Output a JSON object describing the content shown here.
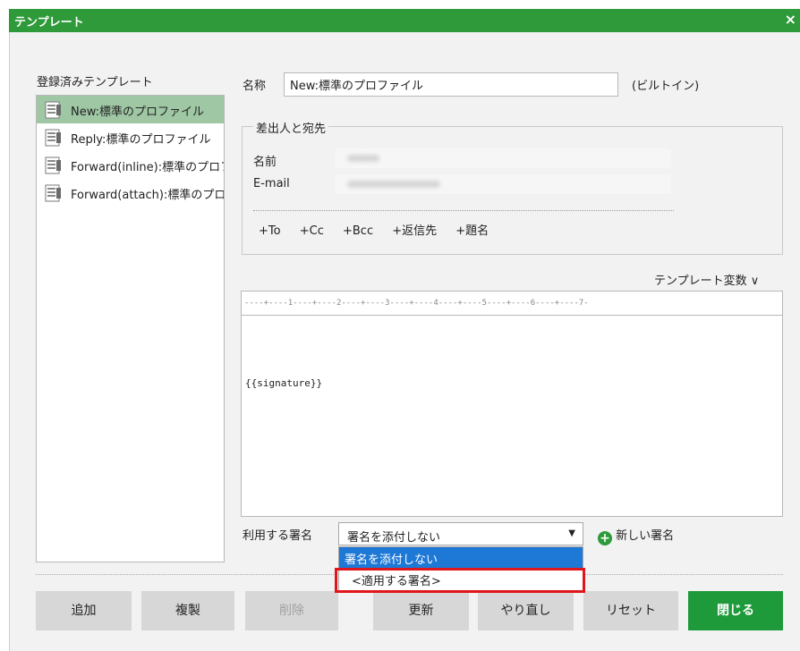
{
  "window": {
    "title": "テンプレート",
    "close_glyph": "×"
  },
  "left": {
    "title": "登録済みテンプレート",
    "items": [
      {
        "label": "New:標準のプロファイル"
      },
      {
        "label": "Reply:標準のプロファイル"
      },
      {
        "label": "Forward(inline):標準のプロファイル"
      },
      {
        "label": "Forward(attach):標準のプロファイル"
      }
    ]
  },
  "form": {
    "name_label": "名称",
    "name_value": "New:標準のプロファイル",
    "builtin": "(ビルトイン)",
    "sender_legend": "差出人と宛先",
    "sender_name_label": "名前",
    "email_label": "E-mail",
    "header_links": [
      "+To",
      "+Cc",
      "+Bcc",
      "+返信先",
      "+題名"
    ]
  },
  "editor": {
    "template_vars": "テンプレート変数 ∨",
    "ruler": "----+----1----+----2----+----3----+----4----+----5----+----6----+----7-",
    "body": "{{signature}}"
  },
  "signature": {
    "label": "利用する署名",
    "selected": "署名を添付しない",
    "arrow": "▼",
    "new_label": "新しい署名",
    "options": [
      "署名を添付しない",
      "<適用する署名>"
    ]
  },
  "buttons": {
    "add": "追加",
    "duplicate": "複製",
    "delete": "削除",
    "update": "更新",
    "redo": "やり直し",
    "reset": "リセット",
    "close": "閉じる"
  },
  "colors": {
    "titlebar": "#2e9a3a",
    "selected_item": "#9fc7a4",
    "dropdown_highlight": "#1e78d6",
    "highlight_box": "#e0161c",
    "close_button": "#1f9a3b"
  }
}
